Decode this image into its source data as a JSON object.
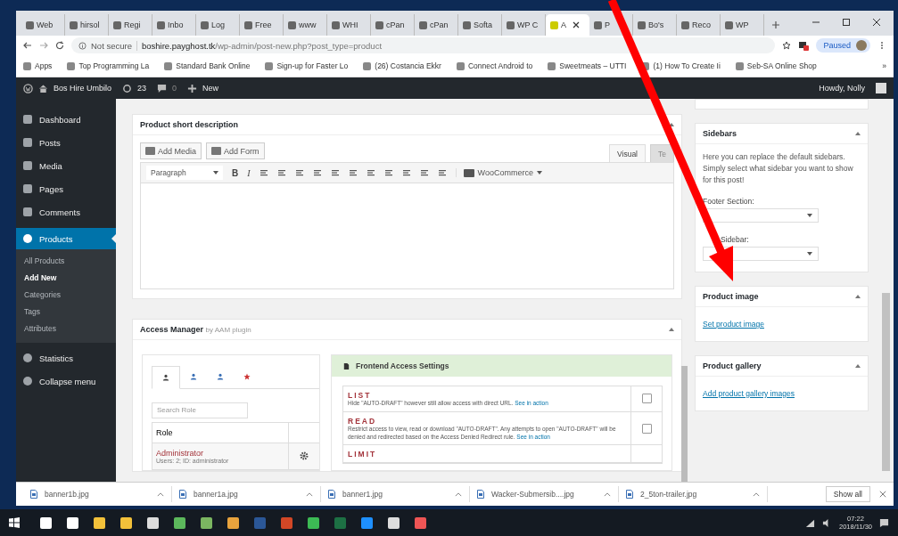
{
  "browser": {
    "tabs": [
      {
        "label": "Web",
        "selected": false
      },
      {
        "label": "hirsol",
        "selected": false
      },
      {
        "label": "Regi",
        "selected": false
      },
      {
        "label": "Inbo",
        "selected": false
      },
      {
        "label": "Log",
        "selected": false
      },
      {
        "label": "Free",
        "selected": false
      },
      {
        "label": "www",
        "selected": false
      },
      {
        "label": "WHI",
        "selected": false
      },
      {
        "label": "cPan",
        "selected": false
      },
      {
        "label": "cPan",
        "selected": false
      },
      {
        "label": "Softa",
        "selected": false
      },
      {
        "label": "WP C",
        "selected": false
      },
      {
        "label": "A",
        "selected": true
      },
      {
        "label": "P",
        "selected": false
      },
      {
        "label": "Bo's",
        "selected": false
      },
      {
        "label": "Reco",
        "selected": false
      },
      {
        "label": "WP",
        "selected": false
      }
    ],
    "address": {
      "security": "Not secure",
      "host": "boshire.payghost.tk",
      "path": "/wp-admin/post-new.php?post_type=product"
    },
    "profile": "Paused",
    "bookmarks": [
      "Apps",
      "Top Programming La",
      "Standard Bank Online",
      "Sign-up for Faster Lo",
      "(26) Costancia Ekkr",
      "Connect Android to",
      "Sweetmeats – UTTI",
      "(1) How To Create Ii",
      "Seb-SA Online Shop"
    ],
    "more_bookmarks": "»"
  },
  "admin_bar": {
    "site": "Bos Hire Umbilo",
    "updates": "23",
    "comments": "0",
    "new": "New",
    "greeting": "Howdy, Nolly"
  },
  "menu": [
    {
      "label": "Dashboard",
      "selected": false
    },
    {
      "label": "Posts",
      "selected": false
    },
    {
      "label": "Media",
      "selected": false
    },
    {
      "label": "Pages",
      "selected": false
    },
    {
      "label": "Comments",
      "selected": false
    },
    {
      "label": "Products",
      "selected": true
    }
  ],
  "submenu": [
    {
      "label": "All Products",
      "selected": false
    },
    {
      "label": "Add New",
      "selected": true
    },
    {
      "label": "Categories",
      "selected": false
    },
    {
      "label": "Tags",
      "selected": false
    },
    {
      "label": "Attributes",
      "selected": false
    }
  ],
  "menu_after": [
    {
      "label": "Statistics",
      "selected": false
    },
    {
      "label": "Collapse menu",
      "selected": false
    }
  ],
  "short_description": {
    "title": "Product short description",
    "media_buttons": [
      "Add Media",
      "Add Form"
    ],
    "editor_tabs": [
      {
        "label": "Visual",
        "selected": true
      },
      {
        "label": "Te",
        "selected": false
      }
    ],
    "format": "Paragraph",
    "bold": "B",
    "italic": "I",
    "shortcodes": "WooCommerce"
  },
  "access_manager": {
    "title": "Access Manager",
    "subtitle": "by AAM plugin",
    "role_tabs": [
      {
        "selected": true
      },
      {
        "selected": false
      },
      {
        "selected": false
      },
      {
        "selected": false
      }
    ],
    "search_placeholder": "Search Role",
    "role_column": "Role",
    "roles": [
      {
        "name": "Administrator",
        "meta": "Users: 2; ID: administrator"
      }
    ],
    "settings_title": "Frontend Access Settings",
    "options": [
      {
        "name": "LIST",
        "description": "Hide \"AUTO-DRAFT\" however still allow access with direct URL.",
        "link": "See in action",
        "checked": false
      },
      {
        "name": "READ",
        "description": "Restrict access to view, read or download \"AUTO-DRAFT\". Any attempts to open \"AUTO-DRAFT\" will be denied and redirected based on the Access Denied Redirect rule.",
        "link": "See in action",
        "checked": false
      },
      {
        "name": "LIMIT"
      }
    ]
  },
  "sidebars": {
    "title": "Sidebars",
    "text": "Here you can replace the default sidebars. Simply select what sidebar you want to show for this post!",
    "fields": [
      {
        "label": "Footer Section:"
      },
      {
        "label": "Sidebar:"
      }
    ]
  },
  "product_image": {
    "title": "Product image",
    "link": "Set product image"
  },
  "product_gallery": {
    "title": "Product gallery",
    "link": "Add product gallery images"
  },
  "downloads": {
    "files": [
      "banner1b.jpg",
      "banner1a.jpg",
      "banner1.jpg",
      "Wacker-Submersib....jpg",
      "2_5ton-trailer.jpg"
    ],
    "show_all": "Show all"
  },
  "taskbar": {
    "time": "07:22",
    "date": "2018/11/30"
  }
}
